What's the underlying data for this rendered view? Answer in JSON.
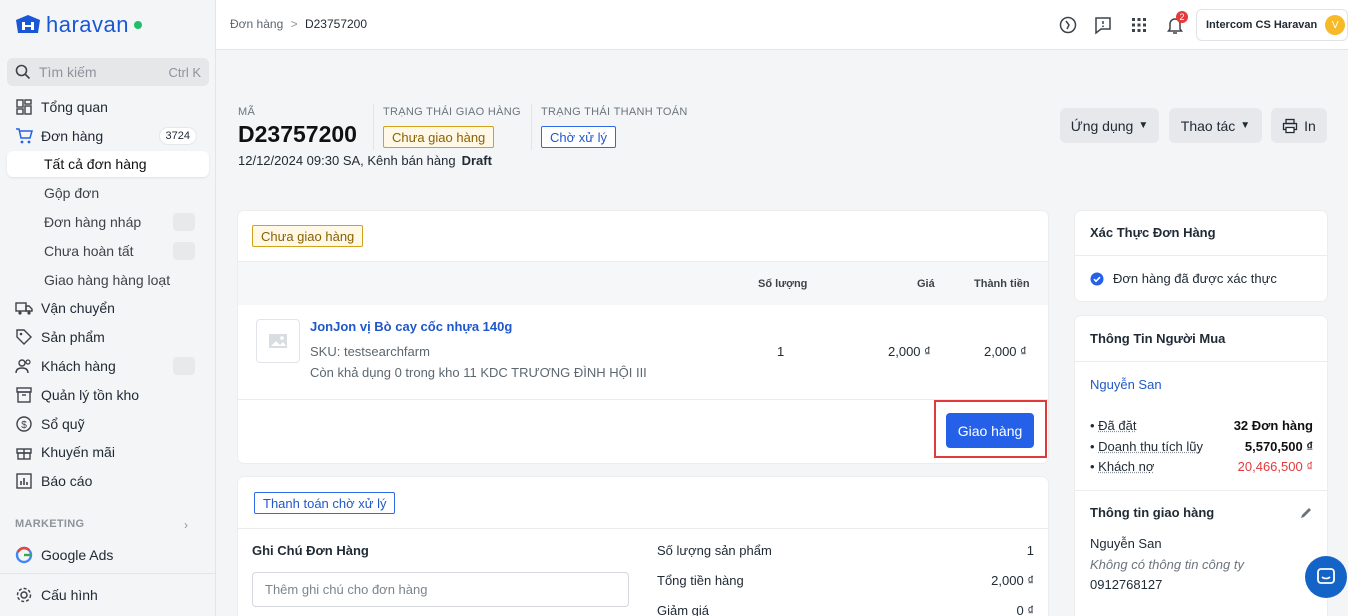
{
  "brand": {
    "name": "haravan",
    "status_color": "#1fbf6b",
    "accent": "#2561e8"
  },
  "search": {
    "placeholder": "Tìm kiếm",
    "shortcut": "Ctrl K"
  },
  "sidebar": {
    "items": [
      {
        "label": "Tổng quan",
        "icon": "dashboard-icon"
      },
      {
        "label": "Đơn hàng",
        "icon": "cart-icon",
        "badge": "3724"
      },
      {
        "label": "Tất cả đơn hàng",
        "active": true
      },
      {
        "label": "Gộp đơn"
      },
      {
        "label": "Đơn hàng nháp",
        "icon_right": "external-icon"
      },
      {
        "label": "Chưa hoàn tất",
        "icon_right": "external-icon"
      },
      {
        "label": "Giao hàng hàng loạt"
      },
      {
        "label": "Vận chuyển",
        "icon": "truck-icon"
      },
      {
        "label": "Sản phẩm",
        "icon": "tag-icon"
      },
      {
        "label": "Khách hàng",
        "icon": "users-icon",
        "icon_right": "external-icon"
      },
      {
        "label": "Quản lý tồn kho",
        "icon": "inventory-icon"
      },
      {
        "label": "Sổ quỹ",
        "icon": "cashbook-icon"
      },
      {
        "label": "Khuyến mãi",
        "icon": "gift-icon"
      },
      {
        "label": "Báo cáo",
        "icon": "report-icon"
      }
    ],
    "marketing_label": "MARKETING",
    "marketing_items": [
      {
        "label": "Google Ads",
        "icon": "google-icon"
      }
    ],
    "settings_label": "Cấu hình"
  },
  "topbar": {
    "breadcrumb_parent": "Đơn hàng",
    "breadcrumb_sep": ">",
    "breadcrumb_current": "D23757200",
    "notification_count": "2",
    "user_name": "Intercom CS Haravan",
    "avatar_letter": "V"
  },
  "order": {
    "code_label": "MÃ",
    "code": "D23757200",
    "date_line": "12/12/2024 09:30 SA, Kênh bán hàng",
    "source": "Draft",
    "fulfillment_label": "TRẠNG THÁI GIAO HÀNG",
    "fulfillment_status": "Chưa giao hàng",
    "payment_label": "TRẠNG THÁI THANH TOÁN",
    "payment_status": "Chờ xử lý"
  },
  "actions": {
    "apps": "Ứng dụng",
    "more": "Thao tác",
    "print": "In"
  },
  "fulfillment_card": {
    "status_tag": "Chưa giao hàng",
    "columns": {
      "qty": "Số lượng",
      "price": "Giá",
      "total": "Thành tiền"
    },
    "item": {
      "name": "JonJon vị Bò cay cốc nhựa 140g",
      "sku": "SKU: testsearchfarm",
      "stock": "Còn khả dụng 0 trong kho 11 KDC TRƯƠNG ĐÌNH HỘI III",
      "qty": "1",
      "price": "2,000 ₫",
      "total": "2,000 ₫"
    },
    "ship_button": "Giao hàng"
  },
  "payment_card": {
    "status_tag": "Thanh toán chờ xử lý",
    "note_title": "Ghi Chú Đơn Hàng",
    "note_placeholder": "Thêm ghi chú cho đơn hàng",
    "summary": [
      {
        "label": "Số lượng sản phẩm",
        "value": "1"
      },
      {
        "label": "Tổng tiền hàng",
        "value": "2,000 ₫"
      },
      {
        "label": "Giảm giá",
        "value": "0 ₫"
      }
    ]
  },
  "verification": {
    "title": "Xác Thực Đơn Hàng",
    "text": "Đơn hàng đã được xác thực"
  },
  "buyer": {
    "title": "Thông Tin Người Mua",
    "name": "Nguyễn San",
    "stats": [
      {
        "label": "Đã đặt",
        "value": "32 Đơn hàng"
      },
      {
        "label": "Doanh thu tích lũy",
        "value": "5,570,500 ₫"
      },
      {
        "label": "Khách nợ",
        "value": "20,466,500 ₫"
      }
    ],
    "shipping_title": "Thông tin giao hàng",
    "shipping_name": "Nguyễn San",
    "no_company": "Không có thông tin công ty",
    "phone": "0912768127"
  }
}
